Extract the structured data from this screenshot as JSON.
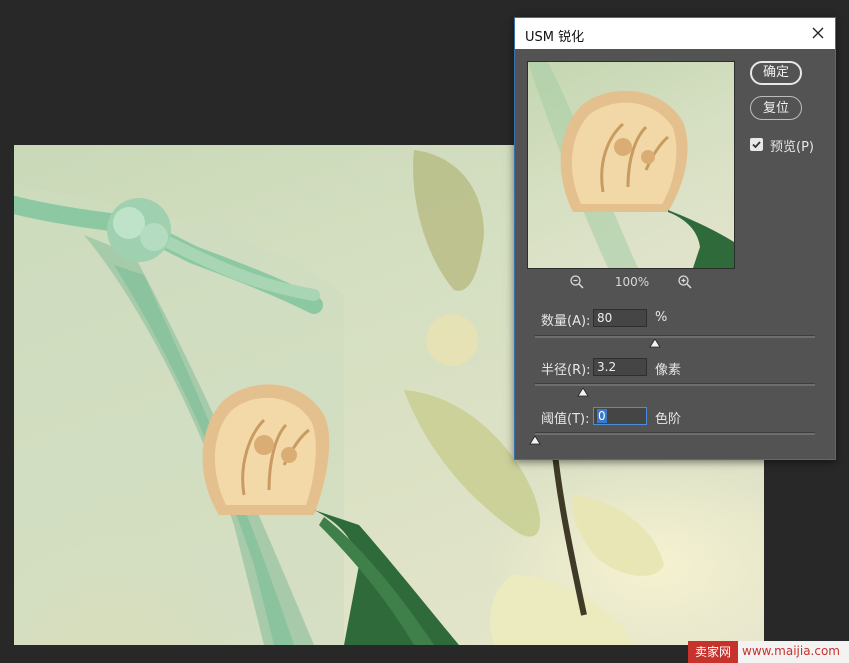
{
  "dialog": {
    "title": "USM 锐化",
    "ok_label": "确定",
    "reset_label": "复位",
    "preview_label": "预览(P)",
    "preview_checked": true,
    "zoom_level": "100%",
    "params": [
      {
        "label": "数量(A):",
        "value": "80",
        "unit": "%",
        "slider_fraction": 0.43
      },
      {
        "label": "半径(R):",
        "value": "3.2",
        "unit": "像素",
        "slider_fraction": 0.17
      },
      {
        "label": "阈值(T):",
        "value": "0",
        "unit": "色阶",
        "slider_fraction": 0.0
      }
    ]
  },
  "watermark": {
    "brand": "卖家网",
    "url": "www.maijia.com"
  },
  "icons": {
    "close": "close-icon",
    "zoom_out": "zoom-out-icon",
    "zoom_in": "zoom-in-icon",
    "check": "check-icon"
  }
}
